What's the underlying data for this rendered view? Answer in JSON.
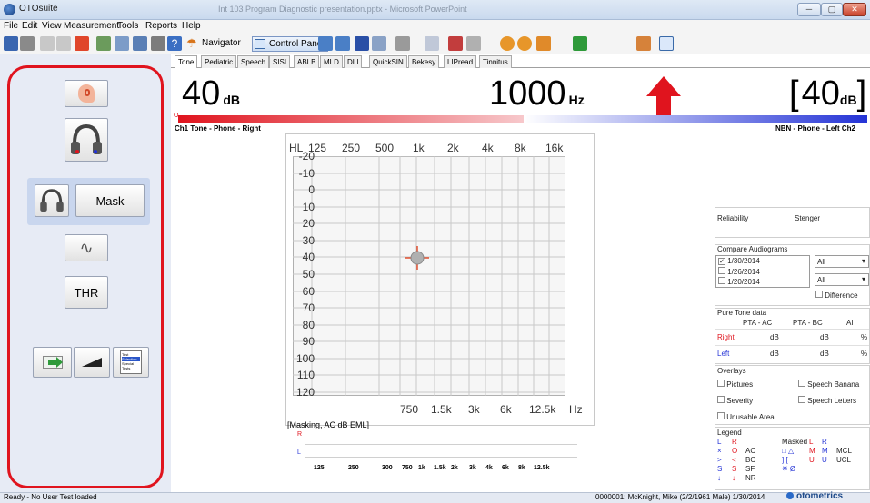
{
  "window": {
    "title": "OTOsuite",
    "blurred_title": "Int 103 Program Diagnostic presentation.pptx - Microsoft PowerPoint",
    "controls": [
      "─",
      "▢",
      "✕"
    ]
  },
  "menu": [
    "File",
    "Edit",
    "View",
    "Measurement",
    "Tools",
    "Reports",
    "Help"
  ],
  "toolbar": {
    "navigator_label": "Navigator",
    "control_panel_label": "Control Panel"
  },
  "tabs": [
    "Tone",
    "Pediatric",
    "Speech",
    "SISI",
    "ABLB",
    "MLD",
    "DLI",
    "QuickSIN",
    "Bekesy",
    "LIPread",
    "Tinnitus"
  ],
  "readout": {
    "left_value": "40",
    "left_unit": "dB",
    "freq_value": "1000",
    "freq_unit": "Hz",
    "right_open": "[",
    "right_value": "40",
    "right_unit": "dB",
    "right_close": "]",
    "ch1_label": "Ch1  Tone - Phone - Right",
    "ch2_label": "NBN - Phone - Left  Ch2",
    "ch1_marker": "O"
  },
  "left_panel": {
    "mask_label": "Mask",
    "thr_label": "THR",
    "wave_symbol": "∿",
    "test_selection_lines": [
      "Test",
      "Selection",
      "Special",
      "Tests"
    ]
  },
  "audiogram": {
    "hl_label": "HL",
    "top_freqs": [
      "125",
      "250",
      "500",
      "1k",
      "2k",
      "4k",
      "8k",
      "16k"
    ],
    "bottom_freqs": [
      "750",
      "1.5k",
      "3k",
      "6k",
      "12.5k"
    ],
    "hz_label": "Hz",
    "levels": [
      "-20",
      "-10",
      "0",
      "10",
      "20",
      "30",
      "40",
      "50",
      "60",
      "70",
      "80",
      "90",
      "100",
      "110",
      "120"
    ],
    "marker_freq": "1000",
    "marker_level": 40
  },
  "masking": {
    "title": "[Masking, AC dB EML]",
    "r_label": "R",
    "l_label": "L",
    "freqs": [
      "125",
      "250",
      "300",
      "750",
      "1k",
      "1.5k",
      "2k",
      "3k",
      "4k",
      "6k",
      "8k",
      "12.5k"
    ]
  },
  "right_panel": {
    "reliability": "Reliability",
    "stenger": "Stenger",
    "compare_title": "Compare Audiograms",
    "dates": [
      "1/30/2014",
      "1/26/2014",
      "1/20/2014"
    ],
    "date_checked": [
      true,
      false,
      false
    ],
    "select_all_1": "All",
    "select_all_2": "All",
    "difference": "Difference",
    "pure_tone_title": "Pure Tone data",
    "pta_ac": "PTA - AC",
    "pta_bc": "PTA - BC",
    "ai": "AI",
    "right_label": "Right",
    "left_label": "Left",
    "db": "dB",
    "pct": "%",
    "overlays_title": "Overlays",
    "overlays": [
      "Pictures",
      "Speech Banana",
      "Severity",
      "Speech Letters",
      "Unusable Area"
    ],
    "legend_title": "Legend",
    "legend_rows": [
      [
        "L",
        "R",
        "",
        "Masked",
        "L",
        "R",
        ""
      ],
      [
        "×",
        "O",
        "AC",
        "□ △",
        "M",
        "M",
        "MCL"
      ],
      [
        ">",
        "<",
        "BC",
        "] [",
        "U",
        "U",
        "UCL"
      ],
      [
        "S",
        "S",
        "SF",
        "※ Ø",
        "",
        "",
        ""
      ],
      [
        "↓",
        "↓",
        "NR",
        "",
        "",
        "",
        ""
      ]
    ]
  },
  "status": {
    "left": "Ready - No User Test loaded",
    "right": "0000001: McKnight, Mike (2/2/1961 Male) 1/30/2014",
    "brand": "otometrics"
  },
  "colors": {
    "accent_red": "#e0141e",
    "left_panel_bg": "#e7ebf5",
    "right_channel": "#e0141e",
    "left_channel": "#2433d6"
  }
}
